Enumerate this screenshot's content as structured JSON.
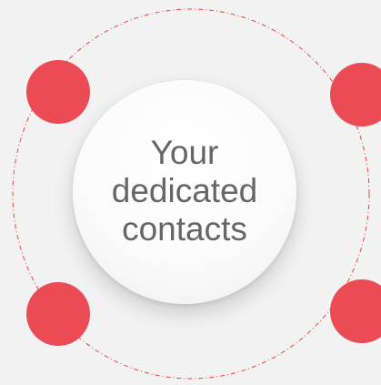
{
  "center": {
    "label": "Your\ndedicated\ncontacts"
  },
  "colors": {
    "background": "#f2f2f2",
    "node": "#eb4b55",
    "ring": "#e8414b",
    "text": "#666666"
  },
  "nodes": [
    {
      "position": "top-left"
    },
    {
      "position": "top-right"
    },
    {
      "position": "bottom-left"
    },
    {
      "position": "bottom-right"
    }
  ]
}
